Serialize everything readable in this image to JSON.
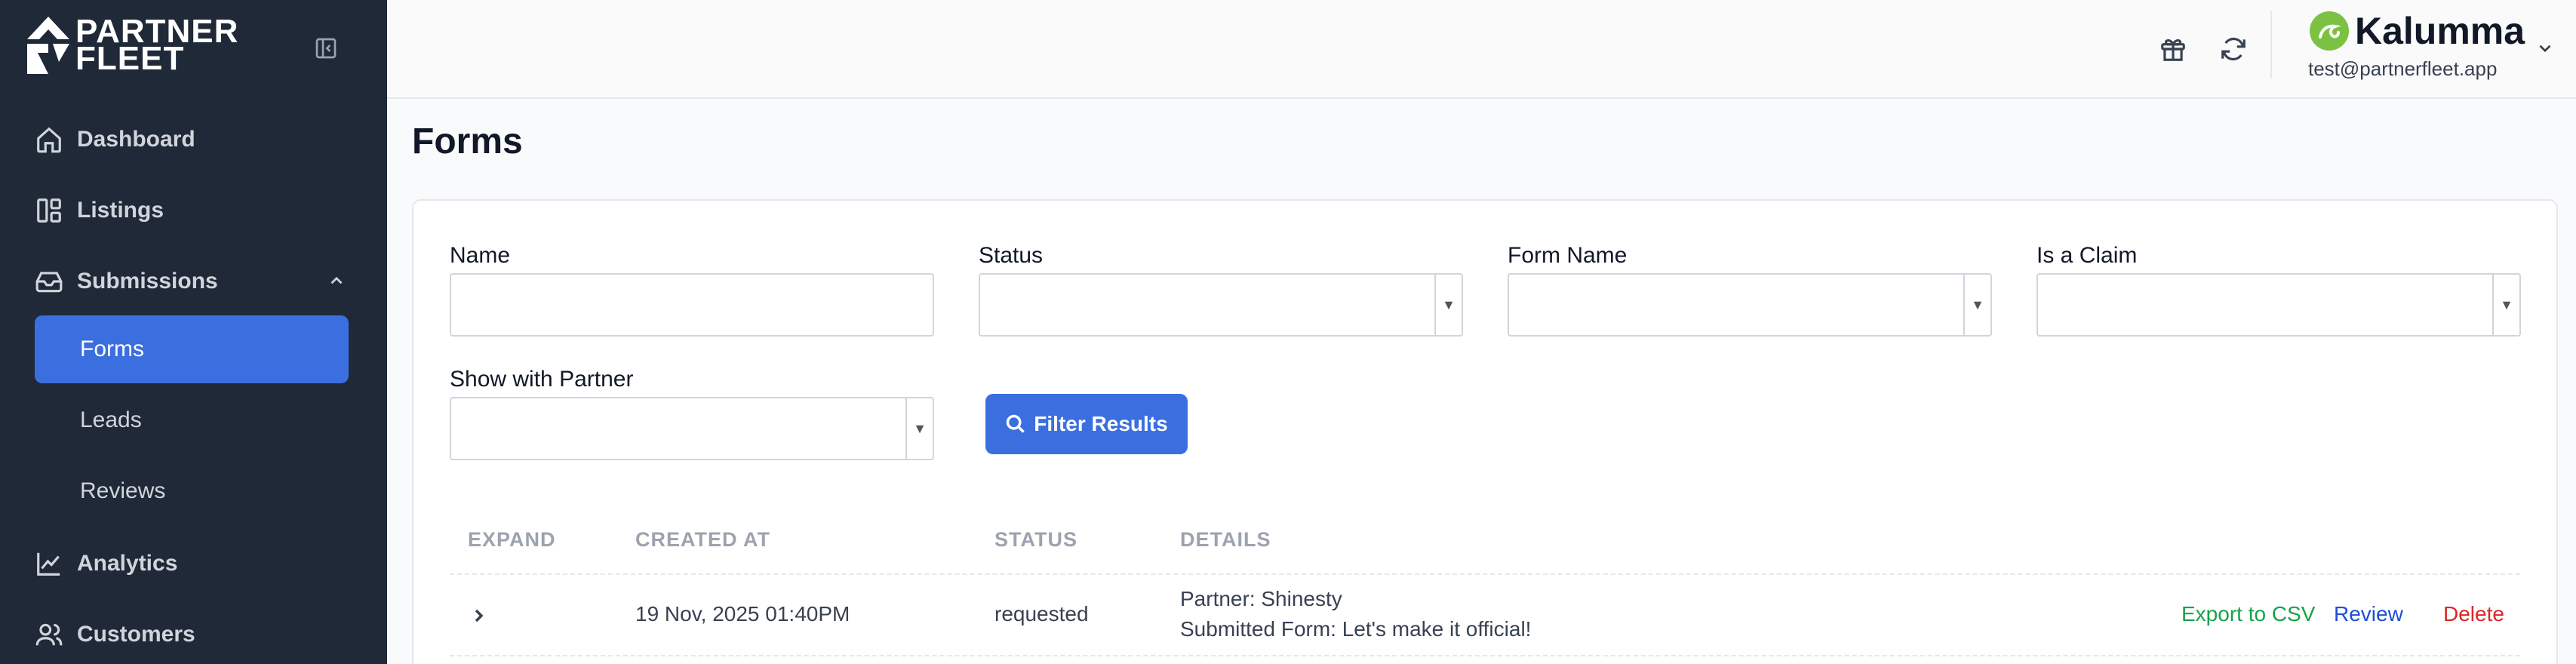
{
  "app": {
    "logo_text_line1": "PARTNER",
    "logo_text_line2": "FLEET"
  },
  "sidebar": {
    "items": [
      {
        "label": "Dashboard",
        "icon": "home-icon"
      },
      {
        "label": "Listings",
        "icon": "layout-icon"
      },
      {
        "label": "Submissions",
        "icon": "inbox-icon",
        "expanded": true
      },
      {
        "label": "Analytics",
        "icon": "chart-line-icon"
      },
      {
        "label": "Customers",
        "icon": "users-icon"
      }
    ],
    "submissions_children": [
      {
        "label": "Forms",
        "active": true
      },
      {
        "label": "Leads",
        "active": false
      },
      {
        "label": "Reviews",
        "active": false
      }
    ]
  },
  "header": {
    "account_name": "Kalumma",
    "account_email": "test@partnerfleet.app",
    "icons": [
      "gift-icon",
      "refresh-icon",
      "chevron-down-icon"
    ]
  },
  "page": {
    "title": "Forms"
  },
  "filters": {
    "name_label": "Name",
    "status_label": "Status",
    "form_name_label": "Form Name",
    "is_claim_label": "Is a Claim",
    "show_partner_label": "Show with Partner",
    "name_value": "",
    "filter_button": "Filter Results"
  },
  "table": {
    "columns": [
      "EXPAND",
      "CREATED AT",
      "STATUS",
      "DETAILS"
    ],
    "rows": [
      {
        "created_at": "19 Nov, 2025 01:40PM",
        "status": "requested",
        "detail_partner": "Partner: Shinesty",
        "detail_form": "Submitted Form: Let's make it official!",
        "actions": {
          "export": "Export to CSV",
          "review": "Review",
          "delete": "Delete"
        }
      }
    ]
  },
  "colors": {
    "sidebar_bg": "#1f2937",
    "accent": "#3b6fe0",
    "export": "#16a34a",
    "review": "#1d4ed8",
    "delete": "#dc2626"
  }
}
